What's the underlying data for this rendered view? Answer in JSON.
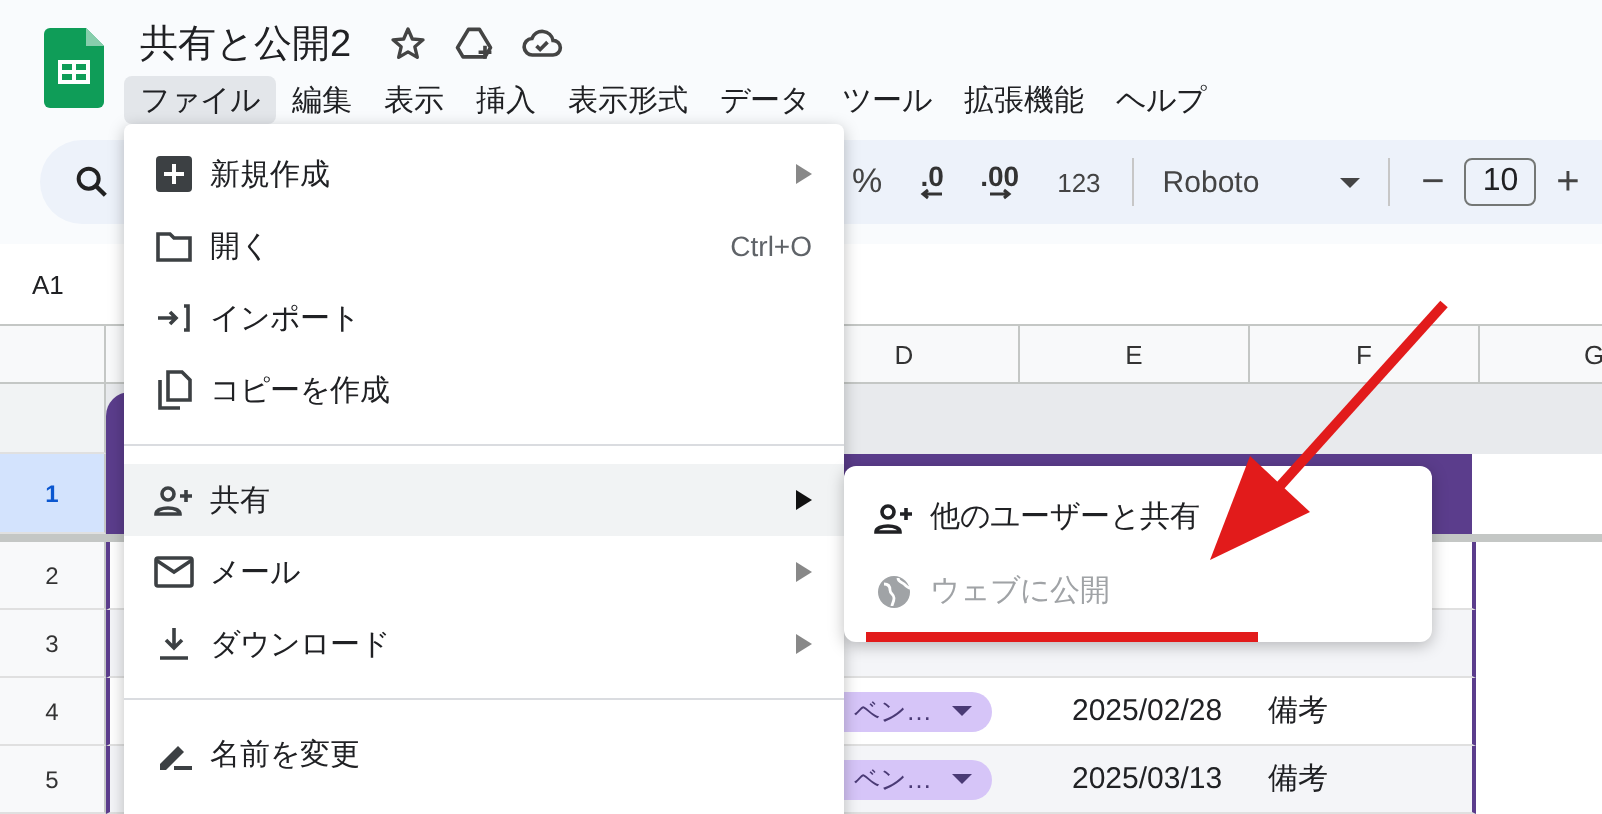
{
  "doc": {
    "title": "共有と公開2"
  },
  "menubar": [
    {
      "label": "ファイル",
      "selected": true
    },
    {
      "label": "編集",
      "selected": false
    },
    {
      "label": "表示",
      "selected": false
    },
    {
      "label": "挿入",
      "selected": false
    },
    {
      "label": "表示形式",
      "selected": false
    },
    {
      "label": "データ",
      "selected": false
    },
    {
      "label": "ツール",
      "selected": false
    },
    {
      "label": "拡張機能",
      "selected": false
    },
    {
      "label": "ヘルプ",
      "selected": false
    }
  ],
  "toolbar": {
    "percent": "%",
    "decimals": [
      {
        "label": ".0"
      },
      {
        "label": ".00"
      }
    ],
    "number_format": "123",
    "font": "Roboto",
    "font_size": "10",
    "minus": "−",
    "plus": "+"
  },
  "name_box": "A1",
  "columns": [
    "D",
    "E",
    "F",
    "G"
  ],
  "rows": [
    {
      "number": "1",
      "selected": true,
      "kind": "header"
    },
    {
      "number": "2",
      "selected": false,
      "kind": "data",
      "cells": []
    },
    {
      "number": "3",
      "selected": false,
      "kind": "data",
      "cells": []
    },
    {
      "number": "4",
      "selected": false,
      "kind": "data",
      "cells": [
        {
          "kind": "chip",
          "text": "ベン…"
        },
        {
          "kind": "date",
          "text": "2025/02/28"
        },
        {
          "kind": "text",
          "text": "備考"
        }
      ]
    },
    {
      "number": "5",
      "selected": false,
      "kind": "data",
      "cells": [
        {
          "kind": "chip",
          "text": "ベン…"
        },
        {
          "kind": "date",
          "text": "2025/03/13"
        },
        {
          "kind": "text",
          "text": "備考"
        }
      ]
    }
  ],
  "file_menu": {
    "items": [
      {
        "kind": "item",
        "label": "新規作成",
        "submenu": true,
        "selected": false
      },
      {
        "kind": "item",
        "label": "開く",
        "shortcut": "Ctrl+O",
        "submenu": false,
        "selected": false
      },
      {
        "kind": "item",
        "label": "インポート",
        "submenu": false,
        "selected": false
      },
      {
        "kind": "item",
        "label": "コピーを作成",
        "submenu": false,
        "selected": false
      },
      {
        "kind": "divider"
      },
      {
        "kind": "item",
        "label": "共有",
        "submenu": true,
        "selected": true
      },
      {
        "kind": "item",
        "label": "メール",
        "submenu": true,
        "selected": false
      },
      {
        "kind": "item",
        "label": "ダウンロード",
        "submenu": true,
        "selected": false
      },
      {
        "kind": "divider"
      },
      {
        "kind": "item",
        "label": "名前を変更",
        "submenu": false,
        "selected": false
      }
    ]
  },
  "share_submenu": {
    "items": [
      {
        "label": "他のユーザーと共有",
        "disabled": false
      },
      {
        "label": "ウェブに公開",
        "disabled": true
      }
    ]
  }
}
